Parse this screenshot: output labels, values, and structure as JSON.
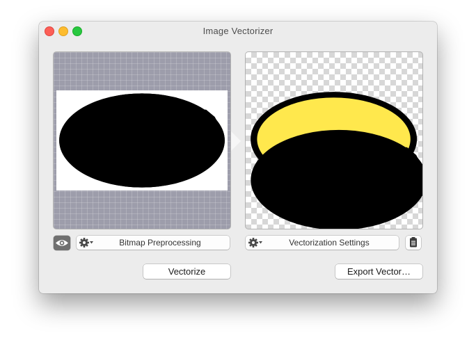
{
  "window": {
    "title": "Image Vectorizer"
  },
  "left_panel": {
    "settings_label": "Bitmap Preprocessing",
    "icons": [
      "gear-icon",
      "chevron-down-icon",
      "eye-icon"
    ]
  },
  "right_panel": {
    "settings_label": "Vectorization Settings",
    "icons": [
      "gear-icon",
      "chevron-down-icon",
      "clipboard-icon"
    ]
  },
  "actions": {
    "vectorize_label": "Vectorize",
    "export_label": "Export Vector…"
  },
  "colors": {
    "bitmap_yellow": "#ffff00",
    "vector_yellow": "#ffe84d",
    "emblem_black": "#000000",
    "close": "#fc5f57",
    "minimize": "#fdbc2e",
    "zoom": "#28c840"
  }
}
